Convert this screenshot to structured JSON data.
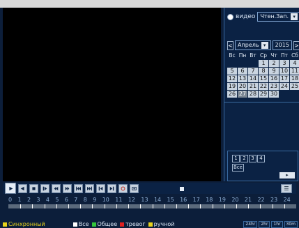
{
  "mode": {
    "label": "видео",
    "dropdown_value": "Чтен.Зап."
  },
  "calendar": {
    "prev": "<",
    "next": ">",
    "month": "Апрель",
    "year": "2015",
    "weekdays": [
      "Вс",
      "Пн",
      "Вт",
      "Ср",
      "Чт",
      "Пт",
      "Сб"
    ],
    "days_rows": [
      [
        "",
        "",
        "",
        "1",
        "2",
        "3",
        "4"
      ],
      [
        "5",
        "6",
        "7",
        "8",
        "9",
        "10",
        "11"
      ],
      [
        "12",
        "13",
        "14",
        "15",
        "16",
        "17",
        "18"
      ],
      [
        "19",
        "20",
        "21",
        "22",
        "23",
        "24",
        "25"
      ],
      [
        "26",
        "27",
        "28",
        "29",
        "30",
        "",
        ""
      ]
    ],
    "recorded_days": [
      "1",
      "2",
      "3",
      "4",
      "5",
      "6",
      "7",
      "8",
      "9",
      "10",
      "11",
      "12",
      "13",
      "14",
      "15",
      "16",
      "17",
      "18",
      "19",
      "20",
      "21",
      "22",
      "23",
      "24",
      "25",
      "26",
      "28",
      "29",
      "30"
    ],
    "selected_day": "27"
  },
  "channels": {
    "items": [
      "1",
      "2",
      "3",
      "4"
    ],
    "all_label": "Все"
  },
  "timeline": {
    "hours": [
      "0",
      "1",
      "2",
      "3",
      "4",
      "5",
      "6",
      "7",
      "8",
      "9",
      "10",
      "11",
      "12",
      "13",
      "14",
      "15",
      "16",
      "17",
      "18",
      "19",
      "20",
      "21",
      "22",
      "23",
      "24"
    ]
  },
  "bottom_bar": {
    "sync_label": "Синхронный",
    "filters": [
      {
        "label": "Все",
        "color": "#ffffff"
      },
      {
        "label": "Общее",
        "color": "#35c53a"
      },
      {
        "label": "тревог",
        "color": "#e02020"
      },
      {
        "label": "ручной",
        "color": "#e6d21c"
      }
    ],
    "zoom": [
      "24hr",
      "2hr",
      "1hr",
      "30m"
    ]
  },
  "colors": {
    "background": "#0c1e3a",
    "accent": "#3a6aa0"
  }
}
